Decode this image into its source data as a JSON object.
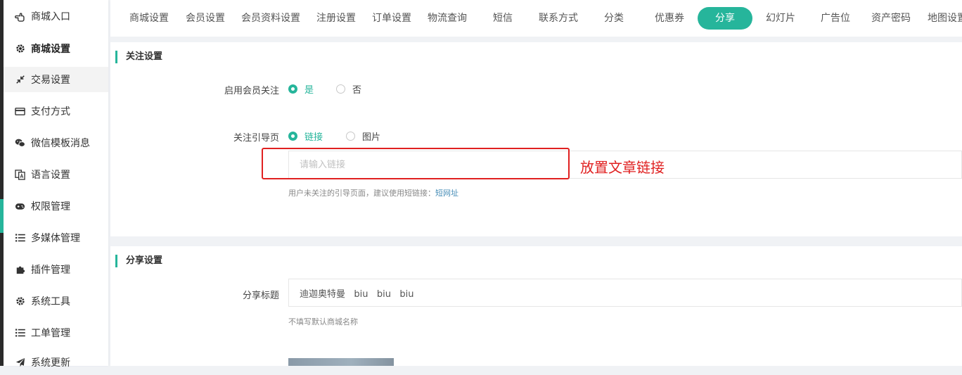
{
  "sidebar": {
    "items": [
      {
        "label": "商城入口",
        "icon": "hand-pointer-icon"
      },
      {
        "label": "商城设置",
        "icon": "gear-icon"
      },
      {
        "label": "交易设置",
        "icon": "compress-arrows-icon"
      },
      {
        "label": "支付方式",
        "icon": "credit-card-icon"
      },
      {
        "label": "微信模板消息",
        "icon": "wechat-icon"
      },
      {
        "label": "语言设置",
        "icon": "translate-icon"
      },
      {
        "label": "权限管理",
        "icon": "gamepad-icon"
      },
      {
        "label": "多媒体管理",
        "icon": "list-icon"
      },
      {
        "label": "插件管理",
        "icon": "puzzle-icon"
      },
      {
        "label": "系统工具",
        "icon": "gear-icon"
      },
      {
        "label": "工单管理",
        "icon": "list-icon"
      },
      {
        "label": "系统更新",
        "icon": "paper-plane-icon"
      }
    ]
  },
  "tabs": [
    "商城设置",
    "会员设置",
    "会员资料设置",
    "注册设置",
    "订单设置",
    "物流查询",
    "短信",
    "联系方式",
    "分类",
    "优惠券",
    "分享",
    "幻灯片",
    "广告位",
    "资产密码",
    "地图设置"
  ],
  "active_tab": "分享",
  "follow": {
    "title": "关注设置",
    "enable_label": "启用会员关注",
    "enable_yes": "是",
    "enable_no": "否",
    "guide_label": "关注引导页",
    "guide_link": "链接",
    "guide_image": "图片",
    "link_placeholder": "请输入链接",
    "link_value": "",
    "hint_text": "用户未关注的引导页面，建议使用短链接：",
    "hint_link": "短网址",
    "annotation": "放置文章链接"
  },
  "share": {
    "title": "分享设置",
    "title_label": "分享标题",
    "title_value": "迪迦奥特曼   biu   biu   biu",
    "title_hint": "不填写默认商城名称"
  },
  "colors": {
    "accent": "#26b59b",
    "annotation": "#e02020"
  }
}
